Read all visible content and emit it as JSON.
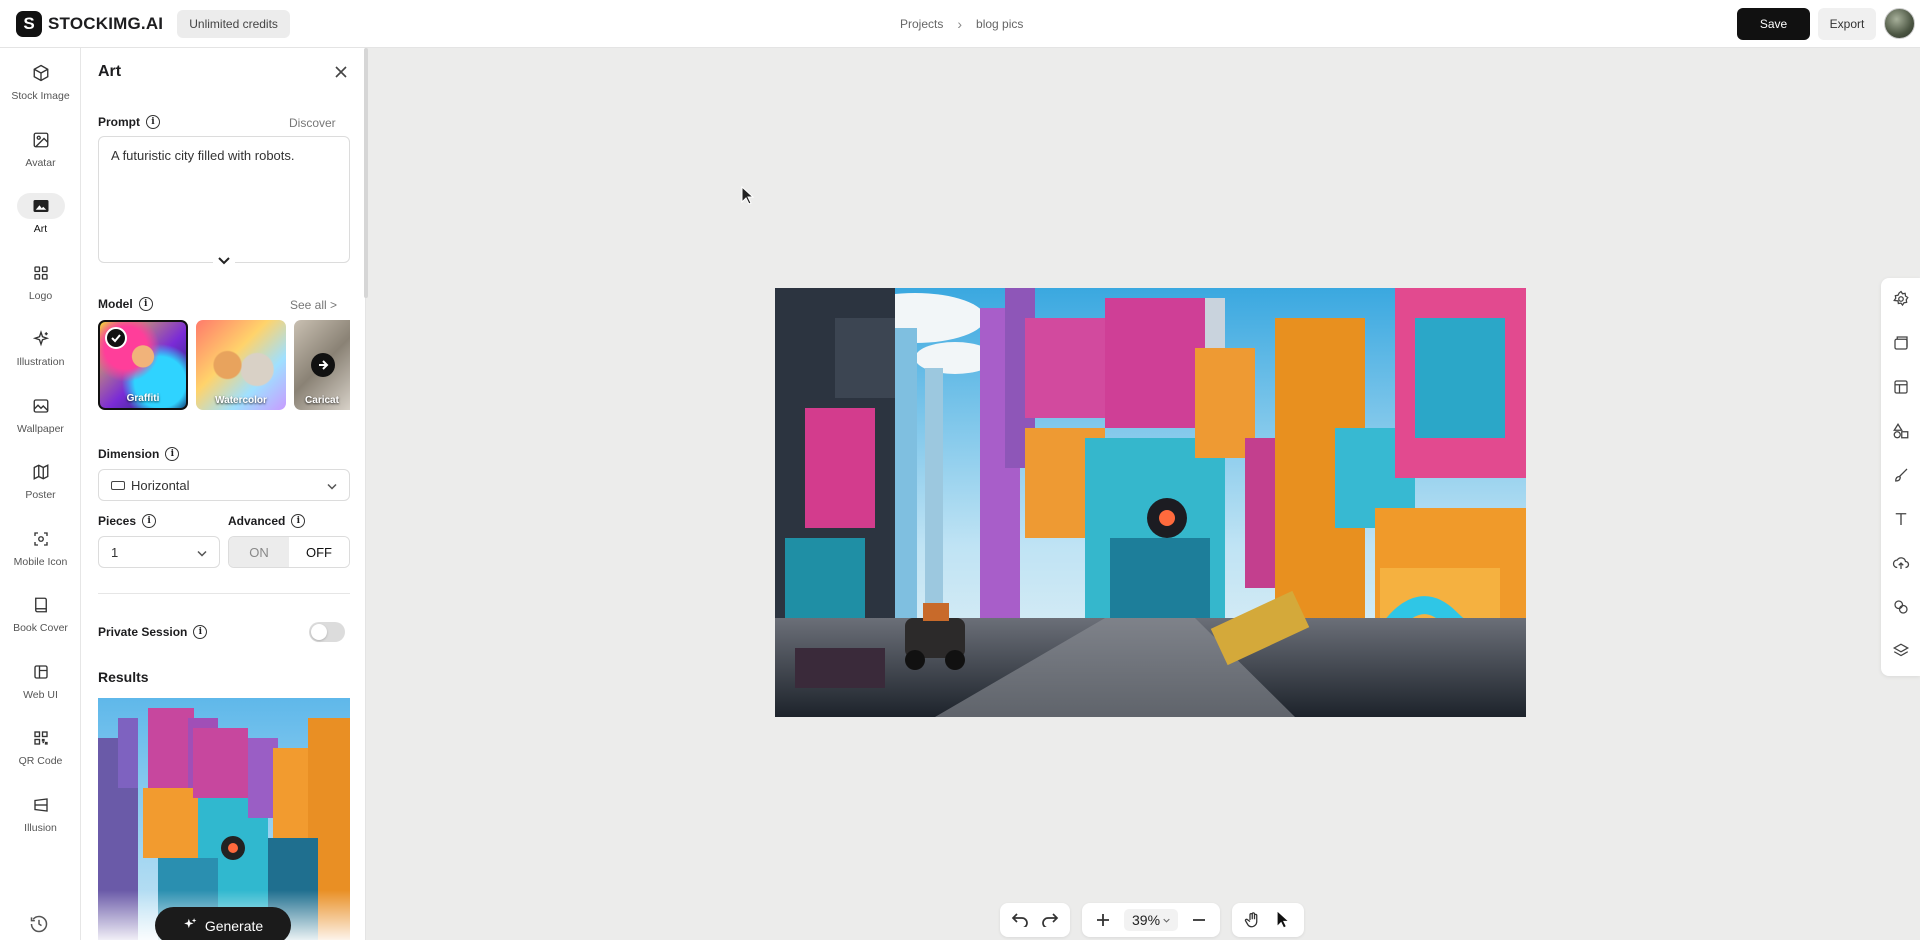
{
  "app": {
    "logo_letter": "S",
    "logo_text": "STOCKIMG.AI",
    "credits_label": "Unlimited credits"
  },
  "breadcrumb": {
    "parent": "Projects",
    "current": "blog pics"
  },
  "actions": {
    "save_label": "Save",
    "export_label": "Export"
  },
  "nav": [
    {
      "id": "stock-image",
      "label": "Stock Image",
      "icon": "cube-icon"
    },
    {
      "id": "avatar",
      "label": "Avatar",
      "icon": "portrait-icon"
    },
    {
      "id": "art",
      "label": "Art",
      "icon": "picture-icon",
      "active": true
    },
    {
      "id": "logo",
      "label": "Logo",
      "icon": "grid-icon"
    },
    {
      "id": "illustration",
      "label": "Illustration",
      "icon": "sparkle-icon"
    },
    {
      "id": "wallpaper",
      "label": "Wallpaper",
      "icon": "landscape-icon"
    },
    {
      "id": "poster",
      "label": "Poster",
      "icon": "map-icon"
    },
    {
      "id": "mobile-icon",
      "label": "Mobile Icon",
      "icon": "scan-icon"
    },
    {
      "id": "book-cover",
      "label": "Book Cover",
      "icon": "book-icon"
    },
    {
      "id": "web-ui",
      "label": "Web UI",
      "icon": "layout-icon"
    },
    {
      "id": "qr-code",
      "label": "QR Code",
      "icon": "qr-icon"
    },
    {
      "id": "illusion",
      "label": "Illusion",
      "icon": "illusion-icon"
    }
  ],
  "panel": {
    "title": "Art",
    "prompt_label": "Prompt",
    "discover_label": "Discover",
    "prompt_text": "A futuristic city filled with robots.",
    "model_label": "Model",
    "see_all_label": "See all >",
    "models": [
      {
        "name": "Graffiti",
        "selected": true
      },
      {
        "name": "Watercolor"
      },
      {
        "name": "Caricat"
      }
    ],
    "dimension_label": "Dimension",
    "dimension_value": "Horizontal",
    "pieces_label": "Pieces",
    "pieces_value": "1",
    "advanced_label": "Advanced",
    "advanced_on": "ON",
    "advanced_off": "OFF",
    "advanced_state": "OFF",
    "private_session_label": "Private Session",
    "private_session_enabled": false,
    "results_label": "Results",
    "generate_label": "Generate"
  },
  "zoom": {
    "value": "39%"
  },
  "colors": {
    "accent": "#111111",
    "canvas_bg": "#ececeb",
    "panel_bg": "#ffffff"
  }
}
